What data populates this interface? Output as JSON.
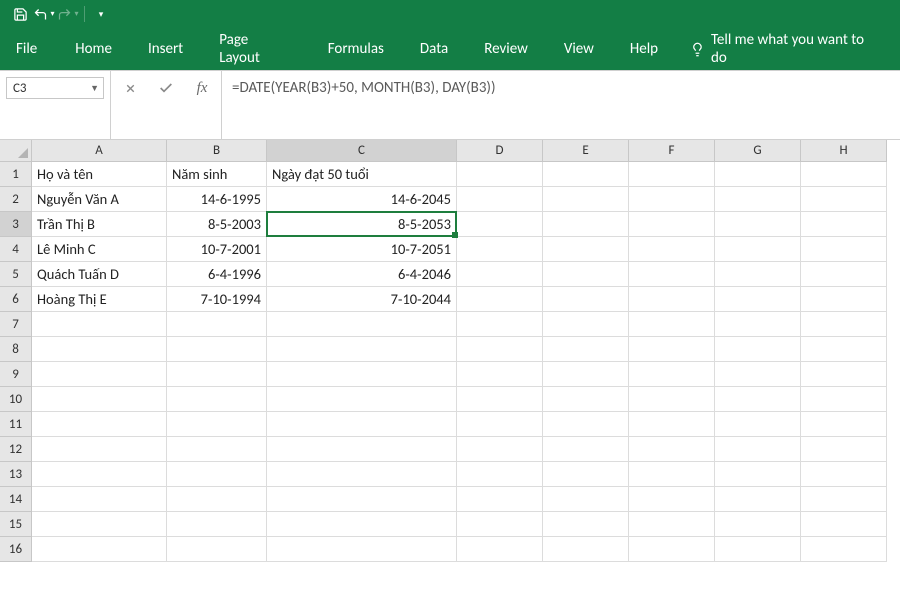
{
  "qat": {
    "save": "save-icon",
    "undo": "undo-icon",
    "redo": "redo-icon"
  },
  "ribbon": {
    "tabs": [
      "File",
      "Home",
      "Insert",
      "Page Layout",
      "Formulas",
      "Data",
      "Review",
      "View",
      "Help"
    ],
    "tellme": "Tell me what you want to do"
  },
  "formulaBar": {
    "nameBox": "C3",
    "formula": "=DATE(YEAR(B3)+50, MONTH(B3), DAY(B3))"
  },
  "columns": [
    "A",
    "B",
    "C",
    "D",
    "E",
    "F",
    "G",
    "H"
  ],
  "rowCount": 16,
  "activeCell": {
    "col": "C",
    "row": 3
  },
  "sheet": {
    "headers": {
      "A": "Họ và tên",
      "B": "Năm sinh",
      "C": "Ngày đạt 50 tuổi"
    },
    "rows": [
      {
        "A": "Nguyễn Văn A",
        "B": "14-6-1995",
        "C": "14-6-2045"
      },
      {
        "A": "Trần Thị B",
        "B": "8-5-2003",
        "C": "8-5-2053"
      },
      {
        "A": "Lê Minh C",
        "B": "10-7-2001",
        "C": "10-7-2051"
      },
      {
        "A": "Quách Tuấn D",
        "B": "6-4-1996",
        "C": "6-4-2046"
      },
      {
        "A": "Hoàng Thị E",
        "B": "7-10-1994",
        "C": "7-10-2044"
      }
    ]
  },
  "colors": {
    "brand": "#137e45",
    "activeBorder": "#1e7e3e"
  }
}
